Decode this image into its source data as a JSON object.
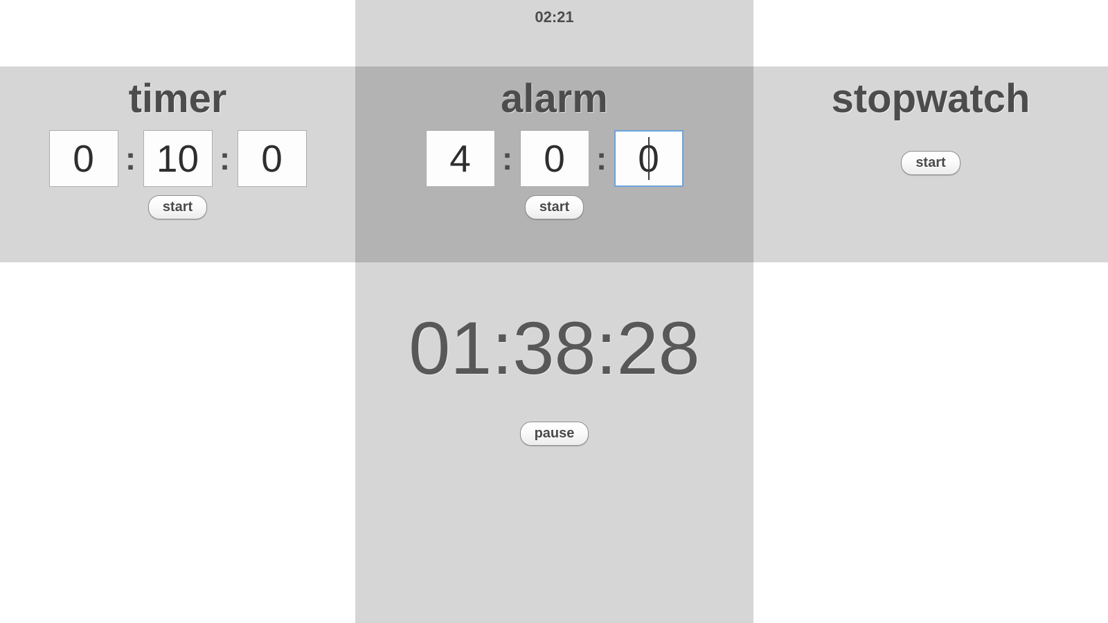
{
  "global_clock": {
    "label": "02:21"
  },
  "colors": {
    "page_background": "#ffffff",
    "panel_background": "#d6d6d6",
    "panel_active_background": "#b3b3b3",
    "text": "#4c4c4c",
    "focus_ring": "#6aa2dc",
    "input_background": "#fdfdfd",
    "big_clock_text": "#585858"
  },
  "panels": {
    "timer": {
      "title": "timer",
      "inputs": [
        {
          "name": "hours",
          "value": "0",
          "focused": false
        },
        {
          "name": "minutes",
          "value": "10",
          "focused": false
        },
        {
          "name": "seconds",
          "value": "0",
          "focused": false
        }
      ],
      "separator": ":",
      "button": "start"
    },
    "alarm": {
      "title": "alarm",
      "active": true,
      "inputs": [
        {
          "name": "hours",
          "value": "4",
          "focused": false
        },
        {
          "name": "minutes",
          "value": "0",
          "focused": false
        },
        {
          "name": "seconds",
          "value": "0",
          "focused": true
        }
      ],
      "separator": ":",
      "button": "start"
    },
    "stopwatch": {
      "title": "stopwatch",
      "button": "start"
    }
  },
  "big_clock": {
    "value": "01:38:28",
    "button": "pause"
  }
}
